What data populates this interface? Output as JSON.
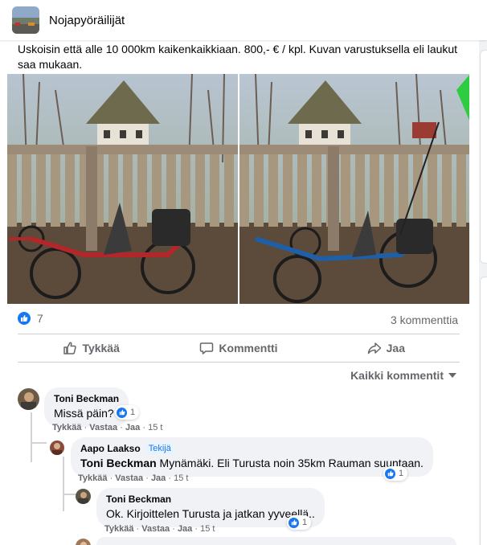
{
  "group": {
    "name": "Nojapyöräilijät"
  },
  "post": {
    "text": "Uskoisin että alle 10 000km kaikenkaikkiaan. 800,- € / kpl. Kuvan varustuksella eli laukut saa mukaan.",
    "photos": [
      {
        "alt": "red-recumbent-trike",
        "frame_color": "#b3262a"
      },
      {
        "alt": "blue-recumbent-trike",
        "frame_color": "#1f5fa8"
      }
    ],
    "reaction_count": "7",
    "comment_count": "3 kommenttia"
  },
  "actions": {
    "like": "Tykkää",
    "comment": "Kommentti",
    "share": "Jaa"
  },
  "sort_label": "Kaikki kommentit",
  "comments": [
    {
      "author": "Toni Beckman",
      "text": "Missä päin?",
      "reactions": "1",
      "meta": {
        "like": "Tykkää",
        "reply": "Vastaa",
        "share": "Jaa",
        "time": "15 t"
      }
    },
    {
      "author": "Aapo Laakso",
      "author_tag": "Tekijä",
      "mention": "Toni Beckman",
      "text": " Mynämäki. Eli Turusta noin 35km Rauman suuntaan.",
      "reactions": "1",
      "meta": {
        "like": "Tykkää",
        "reply": "Vastaa",
        "share": "Jaa",
        "time": "15 t"
      }
    },
    {
      "author": "Toni Beckman",
      "text": "Ok. Kirjoittelen Turusta ja jatkan yyveellä..",
      "reactions": "1",
      "meta": {
        "like": "Tykkää",
        "reply": "Vastaa",
        "share": "Jaa",
        "time": "15 t"
      }
    }
  ],
  "colors": {
    "accent": "#1877f2",
    "secondary_text": "#65676b",
    "bubble": "#f0f2f5"
  }
}
